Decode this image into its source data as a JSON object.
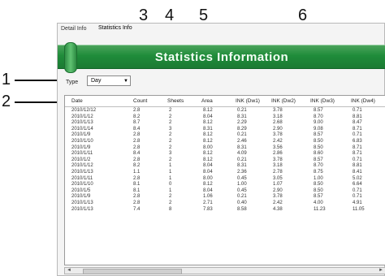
{
  "callouts": [
    "1",
    "2",
    "3",
    "4",
    "5",
    "6"
  ],
  "tabs": [
    {
      "label": "Detail Info"
    },
    {
      "label": "Statistics Info"
    }
  ],
  "banner": {
    "title": "Statistics Information"
  },
  "type_filter": {
    "label": "Type",
    "value": "Day"
  },
  "table": {
    "columns": [
      "Date",
      "Count",
      "Sheets",
      "Area",
      "INK (Dw1)",
      "INK (Dw2)",
      "INK (Dw3)",
      "INK (Dw4)"
    ],
    "rows": [
      [
        "2010/12/12",
        "2.8",
        "2",
        "8.12",
        "0.21",
        "3.78",
        "8.57",
        "0.71"
      ],
      [
        "2010/1/12",
        "8.2",
        "2",
        "8.04",
        "8.31",
        "3.18",
        "8.70",
        "8.81"
      ],
      [
        "2010/1/13",
        "8.7",
        "2",
        "8.12",
        "2.29",
        "2.68",
        "9.00",
        "8.47"
      ],
      [
        "2010/1/14",
        "8.4",
        "3",
        "8.31",
        "8.29",
        "2.90",
        "9.08",
        "8.71"
      ],
      [
        "2010/1/9",
        "2.8",
        "2",
        "8.12",
        "0.21",
        "3.78",
        "8.57",
        "0.71"
      ],
      [
        "2010/1/10",
        "2.8",
        "2",
        "8.12",
        "2.46",
        "2.42",
        "8.50",
        "6.83"
      ],
      [
        "2010/1/9",
        "2.8",
        "2",
        "8.00",
        "8.31",
        "3.56",
        "8.50",
        "8.71"
      ],
      [
        "2010/1/11",
        "8.4",
        "3",
        "8.12",
        "4.09",
        "2.86",
        "8.60",
        "8.71"
      ],
      [
        "2010/1/2",
        "2.8",
        "2",
        "8.12",
        "0.21",
        "3.78",
        "8.57",
        "0.71"
      ],
      [
        "2010/1/12",
        "8.2",
        "1",
        "8.04",
        "8.31",
        "3.18",
        "8.70",
        "8.81"
      ],
      [
        "2010/1/13",
        "1.1",
        "1",
        "8.04",
        "2.36",
        "2.78",
        "8.75",
        "8.41"
      ],
      [
        "2010/1/11",
        "2.8",
        "1",
        "8.00",
        "0.45",
        "3.05",
        "1.00",
        "5.02"
      ],
      [
        "2010/1/10",
        "8.1",
        "0",
        "8.12",
        "1.00",
        "1.07",
        "8.50",
        "6.64"
      ],
      [
        "2010/1/5",
        "8.1",
        "1",
        "8.04",
        "0.45",
        "2.90",
        "8.50",
        "0.71"
      ],
      [
        "2010/1/9",
        "2.8",
        "2",
        "1.06",
        "0.21",
        "3.78",
        "8.57",
        "0.71"
      ],
      [
        "2010/1/13",
        "2.8",
        "2",
        "2.71",
        "0.40",
        "2.42",
        "4.00",
        "4.91"
      ],
      [
        "2010/1/13",
        "7.4",
        "8",
        "7.83",
        "8.58",
        "4.38",
        "11.23",
        "11.05"
      ]
    ]
  }
}
